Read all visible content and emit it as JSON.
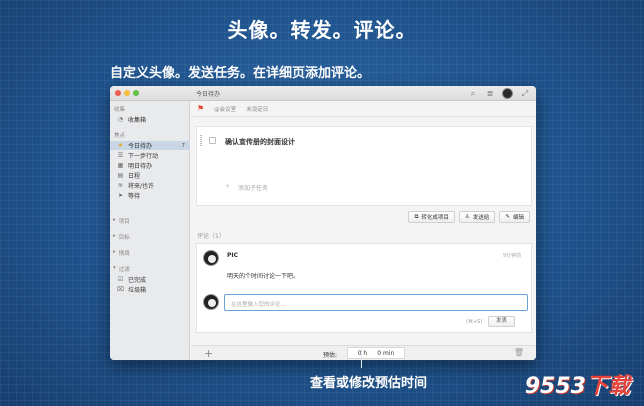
{
  "promo": {
    "headline": "头像。转发。评论。",
    "subline": "自定义头像。发送任务。在详细页添加评论。",
    "caption": "查看或修改预估时间",
    "watermark_main": "9553",
    "watermark_red": "下载"
  },
  "window": {
    "title": "今日待办",
    "toolbar_icons": [
      "search-icon",
      "list-icon",
      "avatar",
      "fullscreen-icon"
    ]
  },
  "sidebar": {
    "group_inbox": "收集",
    "inbox_item": "收集箱",
    "group_focus": "焦点",
    "items": [
      {
        "label": "今日待办",
        "count": "7",
        "icon": "star-icon"
      },
      {
        "label": "下一步行动",
        "count": "",
        "icon": "list-icon"
      },
      {
        "label": "明日待办",
        "count": "",
        "icon": "calendar-icon"
      },
      {
        "label": "日程",
        "count": "",
        "icon": "calendar-icon"
      },
      {
        "label": "将来/也许",
        "count": "",
        "icon": "wifi-icon"
      },
      {
        "label": "等待",
        "count": "",
        "icon": "send-icon"
      }
    ],
    "collapsed": [
      "项目",
      "目标",
      "情境"
    ],
    "group_archive": "过滤",
    "archive_items": [
      "已完成",
      "垃圾箱"
    ]
  },
  "meta": {
    "context": "@会议室",
    "deadline": "未设定日"
  },
  "task": {
    "title": "确认宣传册的封面设计",
    "add_subtask": "添加子任务"
  },
  "actions": {
    "convert": "转化成项目",
    "forward": "发送给",
    "edit": "编辑"
  },
  "comments": {
    "header": "评论（1）",
    "author": "PIC",
    "time": "9分钟前",
    "text": "明天的个时间讨论一下吧。",
    "input_placeholder": "在这里输入您的评论...",
    "hint": "(⌘+S)",
    "send": "发表"
  },
  "bottom": {
    "estimate_label": "预估:",
    "hours": "0 h",
    "minutes": "0 min"
  },
  "colors": {
    "accent": "#2d6aa8",
    "active_row": "#c9d6e6",
    "flag": "#e2462f"
  }
}
